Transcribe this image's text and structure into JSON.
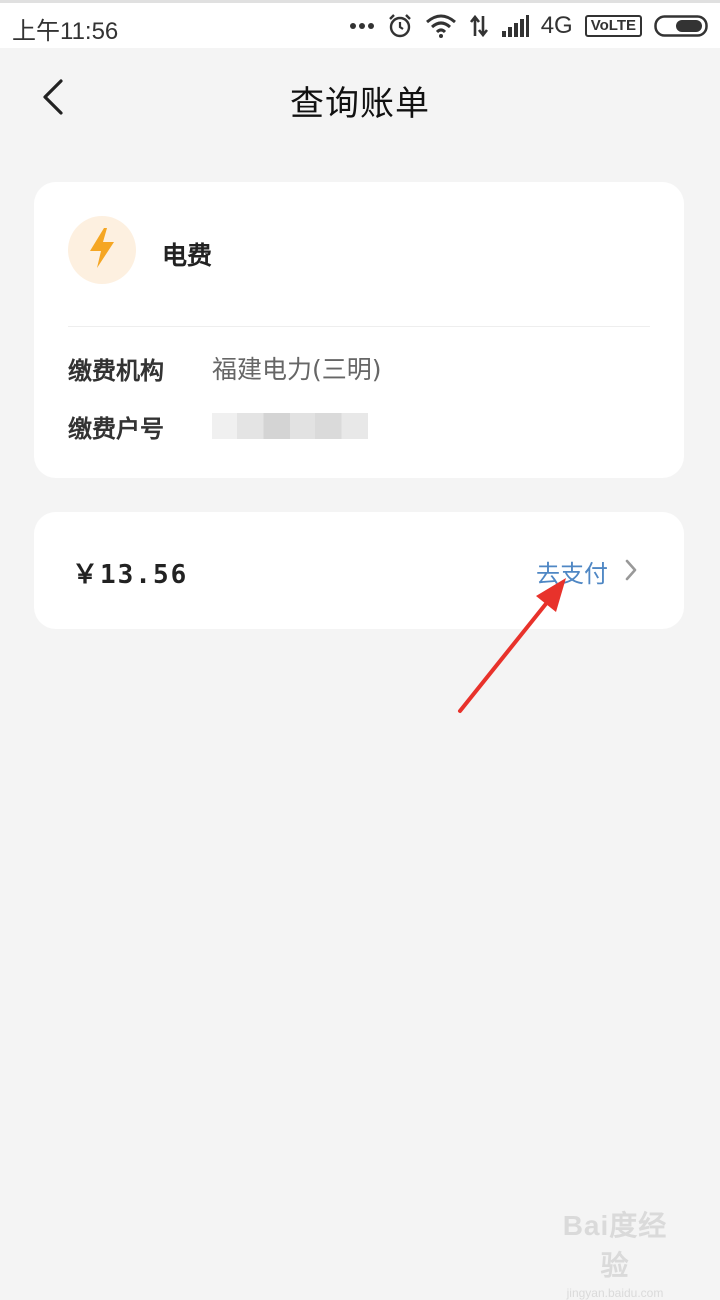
{
  "status_bar": {
    "time": "上午11:56",
    "network": "4G",
    "volte": "VoLTE",
    "icons": [
      "more-dots-icon",
      "alarm-icon",
      "wifi-icon",
      "data-transfer-icon",
      "signal-icon",
      "battery-icon"
    ]
  },
  "nav": {
    "title": "查询账单",
    "back_icon": "chevron-left-icon"
  },
  "bill_info": {
    "icon": "lightning-icon",
    "type": "电费",
    "rows": [
      {
        "label": "缴费机构",
        "value": "福建电力(三明)"
      },
      {
        "label": "缴费户号",
        "value": ""
      }
    ]
  },
  "amount_card": {
    "amount": "￥13.56",
    "pay_label": "去支付",
    "pay_icon": "chevron-right-icon"
  },
  "watermark": {
    "main": "Bai度经验",
    "sub": "jingyan.baidu.com"
  },
  "colors": {
    "background": "#f4f4f4",
    "card": "#ffffff",
    "link": "#4f87c4",
    "icon_accent": "#f5a623",
    "icon_bg": "#fdf0e0",
    "annotation": "#e8322b"
  }
}
